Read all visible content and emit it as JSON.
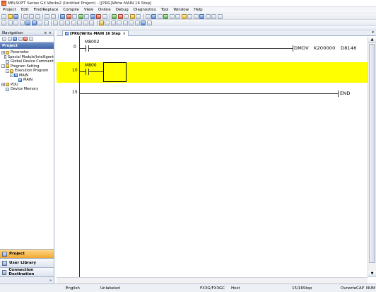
{
  "window": {
    "title": "MELSOFT Series GX Works2 (Untitled Project) - [[PRG]Write MAIN 16 Step]"
  },
  "menu": [
    "Project",
    "Edit",
    "Find/Replace",
    "Compile",
    "View",
    "Online",
    "Debug",
    "Diagnostics",
    "Tool",
    "Window",
    "Help"
  ],
  "navigation": {
    "title": "Navigation",
    "pin": "¤",
    "close": "×",
    "section": "Project",
    "tree": [
      {
        "label": "Parameter",
        "toggle": "+"
      },
      {
        "label": "Special Module(Intelligent",
        "toggle": ""
      },
      {
        "label": "Global Device Comment",
        "toggle": ""
      },
      {
        "label": "Program Setting",
        "toggle": "-"
      },
      {
        "label": "Execution Program",
        "toggle": "-"
      },
      {
        "label": "MAIN",
        "toggle": "-"
      },
      {
        "label": "MAIN",
        "toggle": ""
      },
      {
        "label": "POU",
        "toggle": "+"
      },
      {
        "label": "Device Memory",
        "toggle": ""
      }
    ],
    "bottom_tabs": [
      "Project",
      "User Library",
      "Connection Destination"
    ],
    "strip_arrow": "»"
  },
  "editor": {
    "tab_label": "[PRG]Write MAIN 16 Step",
    "tab_close": "×",
    "tab_menu": "▾",
    "rungs": [
      {
        "step": "0",
        "contact": "M8002",
        "instruction": "DMOV",
        "arg1": "K200000",
        "arg2": "D8146"
      },
      {
        "step": "10",
        "contact": "M800"
      },
      {
        "step": "15",
        "instruction": "END"
      }
    ]
  },
  "status": {
    "language": "English",
    "label": "Unlabeled",
    "plc": "FX3G/FX3GC",
    "station": "Host",
    "steps": "15/16Step",
    "mode": "Ovrwrte",
    "cap": "CAP",
    "num": "NUM"
  },
  "colors": {
    "highlight": "#ffff00",
    "active_tab": "#f2a72e",
    "project_bar": "#3e64a6"
  }
}
